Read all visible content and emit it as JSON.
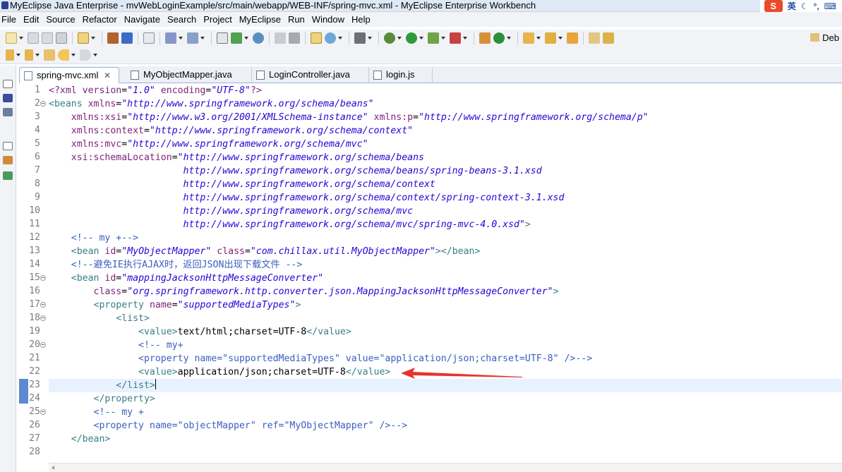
{
  "window": {
    "title": "MyEclipse Java Enterprise - mvWebLoginExample/src/main/webapp/WEB-INF/spring-mvc.xml - MyEclipse Enterprise Workbench",
    "ime_label": "英"
  },
  "menu": [
    "File",
    "Edit",
    "Source",
    "Refactor",
    "Navigate",
    "Search",
    "Project",
    "MyEclipse",
    "Run",
    "Window",
    "Help"
  ],
  "toolbar": {
    "perspective_label": "Deb"
  },
  "tabs": [
    {
      "label": "spring-mvc.xml",
      "active": true,
      "icon": "xml-file-icon"
    },
    {
      "label": "MyObjectMapper.java",
      "active": false,
      "icon": "java-file-icon"
    },
    {
      "label": "LoginController.java",
      "active": false,
      "icon": "java-file-icon"
    },
    {
      "label": "login.js",
      "active": false,
      "icon": "js-file-icon"
    }
  ],
  "editor": {
    "line_numbers": [
      "1",
      "2",
      "3",
      "4",
      "5",
      "6",
      "7",
      "8",
      "9",
      "10",
      "11",
      "12",
      "13",
      "14",
      "15",
      "16",
      "17",
      "18",
      "19",
      "20",
      "21",
      "22",
      "23",
      "24",
      "25",
      "26",
      "27",
      "28"
    ],
    "lines": [
      [
        [
          "pi",
          "<?xml "
        ],
        [
          "attr",
          "version"
        ],
        [
          "txt",
          "="
        ],
        [
          "val",
          "\"1.0\""
        ],
        [
          "txt",
          " "
        ],
        [
          "attr",
          "encoding"
        ],
        [
          "txt",
          "="
        ],
        [
          "val",
          "\"UTF-8\""
        ],
        [
          "pi",
          "?>"
        ]
      ],
      [
        [
          "tag",
          "<beans "
        ],
        [
          "attr",
          "xmlns"
        ],
        [
          "txt",
          "="
        ],
        [
          "val",
          "\"http://www.springframework.org/schema/beans\""
        ]
      ],
      [
        [
          "txt",
          "    "
        ],
        [
          "attr",
          "xmlns:xsi"
        ],
        [
          "txt",
          "="
        ],
        [
          "val",
          "\"http://www.w3.org/2001/XMLSchema-instance\""
        ],
        [
          "txt",
          " "
        ],
        [
          "attr",
          "xmlns:p"
        ],
        [
          "txt",
          "="
        ],
        [
          "val",
          "\"http://www.springframework.org/schema/p\""
        ]
      ],
      [
        [
          "txt",
          "    "
        ],
        [
          "attr",
          "xmlns:context"
        ],
        [
          "txt",
          "="
        ],
        [
          "val",
          "\"http://www.springframework.org/schema/context\""
        ]
      ],
      [
        [
          "txt",
          "    "
        ],
        [
          "attr",
          "xmlns:mvc"
        ],
        [
          "txt",
          "="
        ],
        [
          "val",
          "\"http://www.springframework.org/schema/mvc\""
        ]
      ],
      [
        [
          "txt",
          "    "
        ],
        [
          "attr",
          "xsi:schemaLocation"
        ],
        [
          "txt",
          "="
        ],
        [
          "val",
          "\"http://www.springframework.org/schema/beans"
        ]
      ],
      [
        [
          "val",
          "                        http://www.springframework.org/schema/beans/spring-beans-3.1.xsd"
        ]
      ],
      [
        [
          "val",
          "                        http://www.springframework.org/schema/context"
        ]
      ],
      [
        [
          "val",
          "                        http://www.springframework.org/schema/context/spring-context-3.1.xsd"
        ]
      ],
      [
        [
          "val",
          "                        http://www.springframework.org/schema/mvc"
        ]
      ],
      [
        [
          "val",
          "                        http://www.springframework.org/schema/mvc/spring-mvc-4.0.xsd\""
        ],
        [
          "tag",
          ">"
        ]
      ],
      [
        [
          "txt",
          "    "
        ],
        [
          "cmt",
          "<!-- my +-->"
        ]
      ],
      [
        [
          "txt",
          "    "
        ],
        [
          "tag",
          "<bean "
        ],
        [
          "attr",
          "id"
        ],
        [
          "txt",
          "="
        ],
        [
          "val",
          "\"MyObjectMapper\""
        ],
        [
          "txt",
          " "
        ],
        [
          "attr",
          "class"
        ],
        [
          "txt",
          "="
        ],
        [
          "val",
          "\"com.chillax.util.MyObjectMapper\""
        ],
        [
          "tag",
          "></bean>"
        ]
      ],
      [
        [
          "txt",
          "    "
        ],
        [
          "cmt",
          "<!--避免IE执行AJAX时，返回JSON出现下载文件 -->"
        ]
      ],
      [
        [
          "txt",
          "    "
        ],
        [
          "tag",
          "<bean "
        ],
        [
          "attr",
          "id"
        ],
        [
          "txt",
          "="
        ],
        [
          "val",
          "\"mappingJacksonHttpMessageConverter\""
        ]
      ],
      [
        [
          "txt",
          "        "
        ],
        [
          "attr",
          "class"
        ],
        [
          "txt",
          "="
        ],
        [
          "val",
          "\"org.springframework.http.converter.json.MappingJacksonHttpMessageConverter\""
        ],
        [
          "tag",
          ">"
        ]
      ],
      [
        [
          "txt",
          "        "
        ],
        [
          "tag",
          "<property "
        ],
        [
          "attr",
          "name"
        ],
        [
          "txt",
          "="
        ],
        [
          "val",
          "\"supportedMediaTypes\""
        ],
        [
          "tag",
          ">"
        ]
      ],
      [
        [
          "txt",
          "            "
        ],
        [
          "tag",
          "<list>"
        ]
      ],
      [
        [
          "txt",
          "                "
        ],
        [
          "tag",
          "<value>"
        ],
        [
          "txt",
          "text/html;charset=UTF-8"
        ],
        [
          "tag",
          "</value>"
        ]
      ],
      [
        [
          "txt",
          "                "
        ],
        [
          "cmt",
          "<!-- my+"
        ]
      ],
      [
        [
          "txt",
          "                "
        ],
        [
          "cmt",
          "<property name=\"supportedMediaTypes\" value=\"application/json;charset=UTF-8\" />-->"
        ]
      ],
      [
        [
          "txt",
          "                "
        ],
        [
          "tag",
          "<value>"
        ],
        [
          "txt",
          "application/json;charset=UTF-8"
        ],
        [
          "tag",
          "</value>"
        ]
      ],
      [
        [
          "txt",
          "            "
        ],
        [
          "tag",
          "</list>"
        ]
      ],
      [
        [
          "txt",
          "        "
        ],
        [
          "tag",
          "</property>"
        ]
      ],
      [
        [
          "txt",
          "        "
        ],
        [
          "cmt",
          "<!-- my +"
        ]
      ],
      [
        [
          "txt",
          "        "
        ],
        [
          "cmt",
          "<property name=\"objectMapper\" ref=\"MyObjectMapper\" />-->"
        ]
      ],
      [
        [
          "txt",
          "    "
        ],
        [
          "tag",
          "</bean>"
        ]
      ],
      [
        [
          "txt",
          ""
        ]
      ]
    ],
    "fold_lines": [
      2,
      15,
      17,
      18,
      20,
      25
    ],
    "current_line": 23
  },
  "colors": {
    "tag": "#3a7e87",
    "attr": "#7f1f7c",
    "value": "#2b00d6",
    "comment": "#3a5fbf",
    "annotation_arrow": "#e8322d"
  }
}
